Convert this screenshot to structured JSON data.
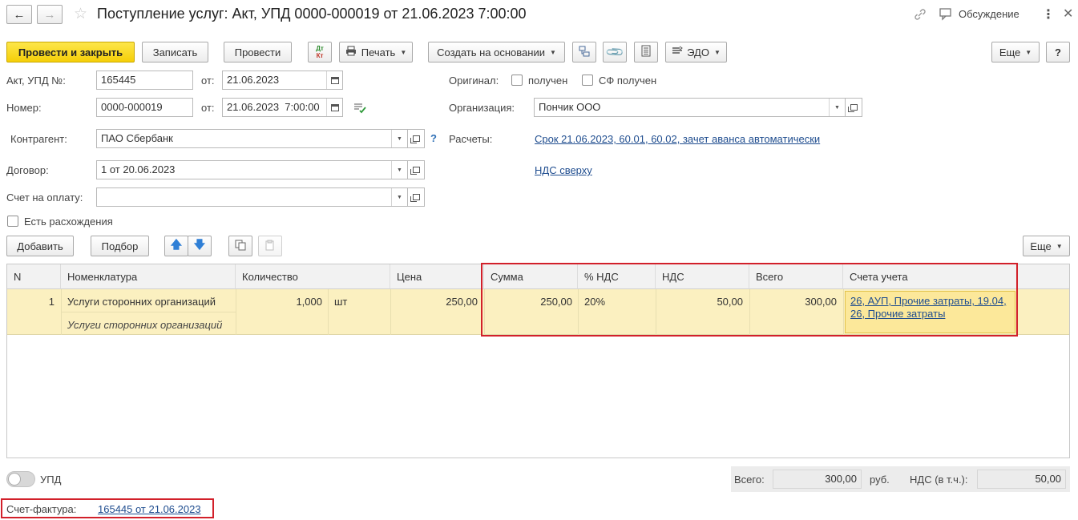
{
  "header": {
    "title": "Поступление услуг: Акт, УПД 0000-000019 от 21.06.2023 7:00:00",
    "discussion": "Обсуждение"
  },
  "toolbar": {
    "post_close": "Провести и закрыть",
    "save": "Записать",
    "post": "Провести",
    "dtkt_top": "Дт",
    "dtkt_bottom": "Кт",
    "print": "Печать",
    "create_based": "Создать на основании",
    "edo": "ЭДО",
    "more": "Еще",
    "help": "?"
  },
  "form": {
    "act_label": "Акт, УПД №:",
    "act_number": "165445",
    "from_label": "от:",
    "act_date": "21.06.2023",
    "number_label": "Номер:",
    "number": "0000-000019",
    "doc_datetime": "21.06.2023  7:00:00",
    "original_label": "Оригинал:",
    "received": "получен",
    "sf_received": "СФ получен",
    "org_label": "Организация:",
    "org": "Пончик ООО",
    "counterparty_label": "Контрагент:",
    "counterparty": "ПАО Сбербанк",
    "question": "?",
    "settlements_label": "Расчеты:",
    "settlements_link": "Срок 21.06.2023, 60.01, 60.02, зачет аванса автоматически",
    "contract_label": "Договор:",
    "contract": "1 от 20.06.2023",
    "vat_link": "НДС сверху",
    "invoice_pay_label": "Счет на оплату:",
    "invoice_pay": "",
    "discrepancy": "Есть расхождения"
  },
  "table_toolbar": {
    "add": "Добавить",
    "pick": "Подбор",
    "more": "Еще"
  },
  "table": {
    "columns": [
      "N",
      "Номенклатура",
      "Количество",
      "Цена",
      "Сумма",
      "% НДС",
      "НДС",
      "Всего",
      "Счета учета"
    ],
    "rows": [
      {
        "n": "1",
        "item": "Услуги сторонних организаций",
        "item_sub": "Услуги сторонних организаций",
        "qty": "1,000",
        "unit": "шт",
        "price": "250,00",
        "sum": "250,00",
        "vat_rate": "20%",
        "vat": "50,00",
        "total": "300,00",
        "accounts_line1": "26, АУП, Прочие затраты, 19.04,",
        "accounts_line2": "26, Прочие затраты"
      }
    ]
  },
  "footer": {
    "upd": "УПД",
    "total_label": "Всего:",
    "total": "300,00",
    "currency": "руб.",
    "vat_label": "НДС (в т.ч.):",
    "vat": "50,00",
    "invoice_label": "Счет-фактура:",
    "invoice_link": "165445 от 21.06.2023"
  },
  "colors": {
    "primary_button": "#f5cf08",
    "selected_row": "#fbf0c0",
    "highlight_box": "#d2202a",
    "link": "#1f4d8f"
  }
}
